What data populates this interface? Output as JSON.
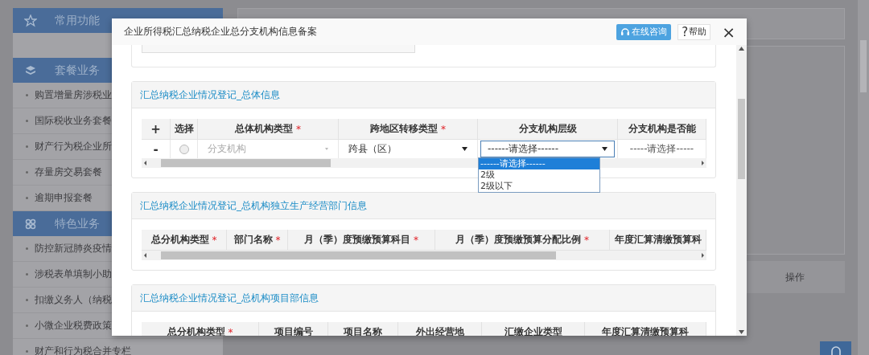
{
  "sidebar": {
    "groups": [
      {
        "title": "常用功能"
      },
      {
        "title": "套餐业务",
        "items": [
          "购置增量房涉税业",
          "国际税收业务套餐",
          "财产行为税企业所",
          "存量房交易套餐",
          "逾期申报套餐"
        ]
      },
      {
        "title": "特色业务",
        "items": [
          "防控新冠肺炎疫情",
          "涉税表单填制小助",
          "扣缴义务人（纳税",
          "小微企业税费政策",
          "财产和行为税合并专栏"
        ]
      }
    ]
  },
  "background_panel": {
    "column_header": "操作"
  },
  "dialog": {
    "title": "企业所得税汇总纳税企业总分支机构信息备案",
    "buttons": [
      {
        "kind": "consult",
        "label": "在线咨询"
      },
      {
        "kind": "help",
        "glyph": "?",
        "label": "帮助"
      }
    ],
    "close": "×",
    "sections": [
      {
        "title": "汇总纳税企业情况登记_总体信息",
        "columns": [
          {
            "kind": "add",
            "label": "+"
          },
          {
            "label": "选择"
          },
          {
            "label": "总体机构类型",
            "mark": "*"
          },
          {
            "label": "跨地区转移类型",
            "mark": "*"
          },
          {
            "label": "分支机构层级"
          },
          {
            "label": "分支机构是否能"
          }
        ],
        "rows": [
          {
            "cells": [
              {
                "kind": "remove",
                "value": "-"
              },
              {
                "kind": "radio",
                "checked": false
              },
              {
                "kind": "select",
                "value": "分支机构",
                "disabled": true,
                "expanded": false
              },
              {
                "kind": "select",
                "value": "跨县（区）",
                "disabled": false,
                "expanded": false
              },
              {
                "kind": "select",
                "value": "------请选择------",
                "disabled": false,
                "expanded": true,
                "options": [
                  {
                    "label": "------请选择------",
                    "selected": true
                  },
                  {
                    "label": "2级",
                    "selected": false
                  },
                  {
                    "label": "2级以下",
                    "selected": false
                  }
                ]
              },
              {
                "kind": "text",
                "value": "-----请选择-----"
              }
            ]
          }
        ]
      },
      {
        "title": "汇总纳税企业情况登记_总机构独立生产经营部门信息",
        "columns": [
          {
            "label": "总分机构类型",
            "mark": "*"
          },
          {
            "label": "部门名称",
            "mark": "*"
          },
          {
            "label": "月（季）度预缴预算科目",
            "mark": "*"
          },
          {
            "label": "月（季）度预缴预算分配比例",
            "mark": "*"
          },
          {
            "label": "年度汇算清缴预算科"
          }
        ]
      },
      {
        "title": "汇总纳税企业情况登记_总机构项目部信息",
        "columns": [
          {
            "label": "总分机构类型",
            "mark": "*"
          },
          {
            "label": "项目编号"
          },
          {
            "label": "项目名称"
          },
          {
            "label": "外出经营地"
          },
          {
            "label": "汇缴企业类型"
          },
          {
            "label": "年度汇算清缴预算科"
          }
        ]
      }
    ]
  }
}
